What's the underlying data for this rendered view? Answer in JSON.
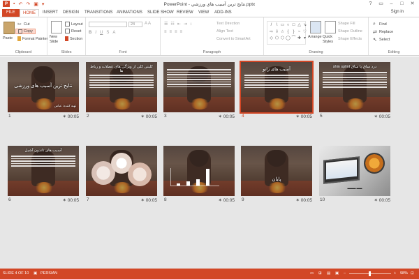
{
  "window": {
    "title": "PowerPoint - نتايج ترين آسیب هاي ورزشي.pptx",
    "controls": [
      "?",
      "▭",
      "–",
      "□",
      "✕"
    ],
    "sign_in": "Sign in"
  },
  "tabs": [
    {
      "label": "FILE"
    },
    {
      "label": "HOME"
    },
    {
      "label": "INSERT"
    },
    {
      "label": "DESIGN"
    },
    {
      "label": "TRANSITIONS"
    },
    {
      "label": "ANIMATIONS"
    },
    {
      "label": "SLIDE SHOW"
    },
    {
      "label": "REVIEW"
    },
    {
      "label": "VIEW"
    },
    {
      "label": "ADD-INS"
    }
  ],
  "ribbon": {
    "clipboard": {
      "paste": "Paste",
      "cut": "Cut",
      "copy": "Copy",
      "format_painter": "Format Painter",
      "label": "Clipboard"
    },
    "slides": {
      "new_slide": "New Slide",
      "layout": "Layout",
      "reset": "Reset",
      "section": "Section",
      "label": "Slides"
    },
    "font": {
      "label": "Font",
      "size": "24"
    },
    "paragraph": {
      "text_direction": "Text Direction",
      "align_text": "Align Text",
      "convert_smartart": "Convert to SmartArt",
      "label": "Paragraph"
    },
    "drawing": {
      "arrange": "Arrange",
      "quick_styles": "Quick Styles",
      "shape_fill": "Shape Fill",
      "shape_outline": "Shape Outline",
      "shape_effects": "Shape Effects",
      "label": "Drawing"
    },
    "editing": {
      "find": "Find",
      "replace": "Replace",
      "select": "Select",
      "label": "Editing"
    }
  },
  "slides": [
    {
      "num": "1",
      "time": "00:05",
      "title": "نتایج ترین آسیب های ورزشی",
      "footer": "تهیه کننده: عباس"
    },
    {
      "num": "2",
      "time": "00:05",
      "title": "کلیتی کلی از ویژگی های عضلات و رباط ها"
    },
    {
      "num": "3",
      "time": "00:05",
      "title": ""
    },
    {
      "num": "4",
      "time": "00:05",
      "title": "آسیب های زانو"
    },
    {
      "num": "5",
      "time": "00:05",
      "title": "shin splint درد ساق پا ساق"
    },
    {
      "num": "6",
      "time": "00:05",
      "title": "آسیب های تاندون آشیل"
    },
    {
      "num": "7",
      "time": "00:05",
      "title": ""
    },
    {
      "num": "8",
      "time": "00:05",
      "title": ""
    },
    {
      "num": "9",
      "time": "00:05",
      "title": "پایان"
    },
    {
      "num": "10",
      "time": "00:05",
      "title": ""
    }
  ],
  "status": {
    "slide": "SLIDE 4 OF 10",
    "language": "PERSIAN",
    "zoom": "98%"
  },
  "colors": {
    "accent": "#d24726",
    "background": "#e6e6e6"
  }
}
